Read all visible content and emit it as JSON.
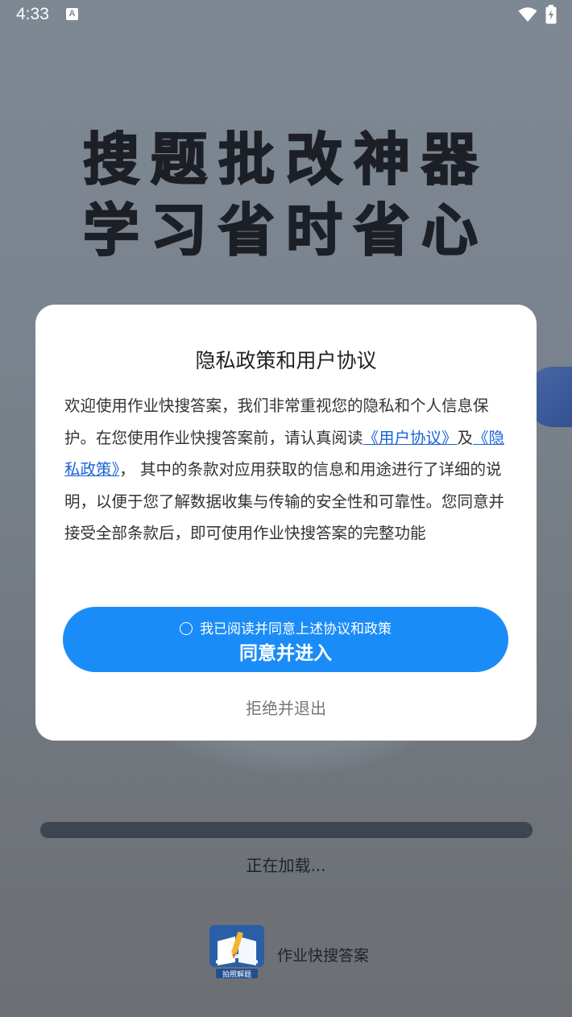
{
  "status_bar": {
    "time": "4:33",
    "notification_icon": "A"
  },
  "splash": {
    "slogan_line1": "搜题批改神器",
    "slogan_line2": "学习省时省心",
    "loading_text": "正在加载...",
    "progress": 1.0,
    "app_name": "作业快搜答案",
    "logo_caption": "拍照解题"
  },
  "dialog": {
    "title": "隐私政策和用户协议",
    "body_part1": "欢迎使用作业快搜答案，我们非常重视您的隐私和个人信息保护。在您使用作业快搜答案前，请认真阅读",
    "user_agreement_link": "《用户协议》",
    "body_part2": "及",
    "privacy_policy_link": "《隐私政策》",
    "body_part3": "， 其中的条款对应用获取的信息和用途进行了详细的说明，以便于您了解数据收集与传输的安全性和可靠性。您同意并接受全部条款后，即可使用作业快搜答案的完整功能",
    "consent_checkbox_label": "我已阅读并同意上述协议和政策",
    "consent_checked": false,
    "agree_button_label": "同意并进入",
    "reject_button_label": "拒绝并退出"
  },
  "colors": {
    "accent": "#1a8cf7",
    "link": "#1a63d8"
  }
}
